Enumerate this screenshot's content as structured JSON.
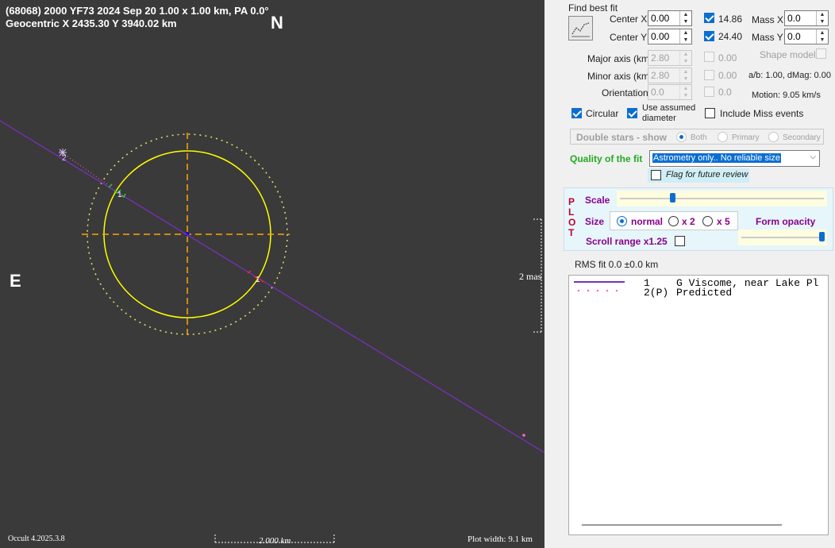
{
  "plot": {
    "title_line1": "(68068) 2000 YF73  2024 Sep 20  1.00 x 1.00 km, PA 0.0°",
    "title_line2": "Geocentric  X  2435.30  Y  3940.02 km",
    "north_label": "N",
    "east_label": "E",
    "mas_label": "2 mas",
    "version": "Occult 4.2025.3.8",
    "scale_label": "2.000 km",
    "plot_width": "Plot width: 9.1 km",
    "chord_marker_1": "1",
    "chord_marker_2": "1",
    "pred_marker": "2"
  },
  "fit": {
    "find_best_fit": "Find best fit",
    "center_x_label": "Center X",
    "center_x_value": "0.00",
    "center_y_label": "Center Y",
    "center_y_value": "0.00",
    "center_x_result": "14.86",
    "center_y_result": "24.40",
    "mass_x_label": "Mass X",
    "mass_x_value": "0.0",
    "mass_y_label": "Mass Y",
    "mass_y_value": "0.0",
    "major_label": "Major axis (km)",
    "major_value": "2.80",
    "major_result": "0.00",
    "minor_label": "Minor axis (km)",
    "minor_value": "2.80",
    "minor_result": "0.00",
    "orient_label": "Orientation",
    "orient_value": "0.0",
    "orient_result": "0.0",
    "shape_model": "Shape model",
    "ab_dmag": "a/b: 1.00, dMag: 0.00",
    "motion": "Motion: 9.05 km/s",
    "circular": "Circular",
    "use_assumed_1": "Use assumed",
    "use_assumed_2": "diameter",
    "include_miss": "Include Miss events",
    "double_stars": "Double stars - show",
    "both": "Both",
    "primary": "Primary",
    "secondary": "Secondary",
    "quality_label": "Quality of the fit",
    "quality_value": "Astrometry only.. No reliable size",
    "flag_review": "Flag for future review"
  },
  "plotpanel": {
    "vertical_label": "P L O T",
    "scale": "Scale",
    "size": "Size",
    "normal": "normal",
    "x2": "x 2",
    "x5": "x 5",
    "form_opacity": "Form opacity",
    "scroll_range": "Scroll range x1.25",
    "scale_pct": 0.26,
    "opacity_pct": 0.97
  },
  "rms": "RMS fit 0.0 ±0.0 km",
  "legend": [
    {
      "num": "1",
      "text": "G Viscome, near Lake Pl"
    },
    {
      "num": "2(P)",
      "text": "Predicted"
    }
  ],
  "colors": {
    "plot_bg": "#3a3a3a",
    "asteroid": "#ffff00",
    "chord": "#7b2fbf",
    "axes": "#ffa500",
    "accent": "#0a6ed1"
  }
}
